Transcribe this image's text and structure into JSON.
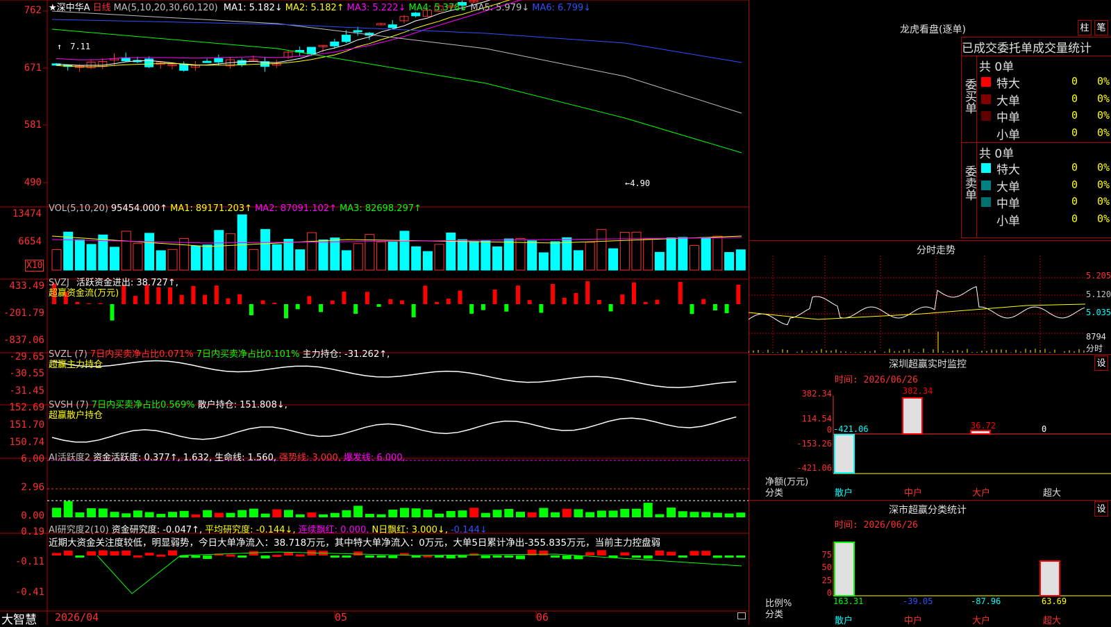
{
  "main": {
    "title": "★深中华A",
    "period": "日线",
    "ma_spec": "MA(5,10,20,30,60,120)",
    "ma": [
      {
        "label": "MA1:",
        "value": "5.182↓",
        "color": "#ffffff"
      },
      {
        "label": "MA2:",
        "value": "5.182↑",
        "color": "#ffff00"
      },
      {
        "label": "MA3:",
        "value": "5.222↓",
        "color": "#ff00ff"
      },
      {
        "label": "MA4:",
        "value": "5.378↓",
        "color": "#00ff00"
      },
      {
        "label": "MA5:",
        "value": "5.979↓",
        "color": "#c0c0c0"
      },
      {
        "label": "MA6:",
        "value": "6.799↓",
        "color": "#3050ff"
      }
    ],
    "y_labels": [
      "762",
      "671",
      "581",
      "490"
    ],
    "high_mark": "7.11",
    "low_mark": "←4.90"
  },
  "vol": {
    "header": "VOL(5,10,20)",
    "value": "95454.000↑",
    "ma": [
      {
        "label": "MA1:",
        "value": "89171.203↑",
        "color": "#ffff00"
      },
      {
        "label": "MA2:",
        "value": "87091.102↑",
        "color": "#ff00ff"
      },
      {
        "label": "MA3:",
        "value": "82698.297↑",
        "color": "#00ff00"
      }
    ],
    "y_labels": [
      "13474",
      "6654"
    ],
    "unit": "X10"
  },
  "svzj": {
    "name": "SVZJ",
    "text": "活跃资金进出: 38.727↑,",
    "sub": "超赢资金流(万元)",
    "y_labels": [
      "433.49",
      "-201.79",
      "-837.06"
    ]
  },
  "svzl": {
    "name": "SVZL (7)",
    "t1": "7日内买卖净占比0.071%",
    "t2": "7日内买卖净占比0.101%",
    "t3": "主力持仓: -31.262↑,",
    "sub": "超赢主力持仓",
    "y_labels": [
      "-29.65",
      "-30.55",
      "-31.45"
    ]
  },
  "svsh": {
    "name": "SVSH (7)",
    "t1": "7日内买卖净占比0.569%",
    "t2": "散户持仓: 151.808↓,",
    "sub": "超赢散户持仓",
    "y_labels": [
      "152.69",
      "151.70",
      "150.74"
    ]
  },
  "ai_active": {
    "name": "AI活跃度2",
    "t1": "资金活跃度: 0.377↑,",
    "t2": "1.632,",
    "t3": "生命线: 1.560,",
    "t4": "强势线: 3.000,",
    "t5": "爆发线: 6.000,",
    "y_labels": [
      "6.00",
      "2.96",
      "0.00"
    ]
  },
  "ai_research": {
    "name": "AI研究度2(10)",
    "t1": "资金研究度: -0.047↑,",
    "t2": "平均研究度: -0.144↓,",
    "t3": "连续飘红: 0.000,",
    "t4": "N日飘红: 3.000↓,",
    "t5": "-0.144↓",
    "comment": "近期大资金关注度较低，明显弱势，今日大单净流入：38.718万元，其中特大单净流入：0万元，大单5日累计净出-355.835万元，当前主力控盘弱",
    "y_labels": [
      "0.19",
      "-0.11",
      "-0.41"
    ]
  },
  "bottom": {
    "brand": "大智慧",
    "dates": [
      "2026/04",
      "05",
      "06"
    ]
  },
  "longhu": {
    "title": "龙虎看盘(逐单)",
    "btn1": "柱",
    "btn2": "笔",
    "subtitle": "已成交委托单成交量统计",
    "buy_label": "委买单",
    "sell_label": "委卖单",
    "buy_total": "共 0单",
    "sell_total": "共 0单",
    "buy_rows": [
      {
        "name": "特大",
        "count": "0",
        "pct": "0%",
        "color": "#ff0000"
      },
      {
        "name": "大单",
        "count": "0",
        "pct": "0%",
        "color": "#800000"
      },
      {
        "name": "中单",
        "count": "0",
        "pct": "0%",
        "color": "#600000"
      },
      {
        "name": "小单",
        "count": "0",
        "pct": "0%",
        "color": ""
      }
    ],
    "sell_rows": [
      {
        "name": "特大",
        "count": "0",
        "pct": "0%",
        "color": "#00ffff"
      },
      {
        "name": "大单",
        "count": "0",
        "pct": "0%",
        "color": "#008080"
      },
      {
        "name": "中单",
        "count": "0",
        "pct": "0%",
        "color": "#007070"
      },
      {
        "name": "小单",
        "count": "0",
        "pct": "0%",
        "color": ""
      }
    ]
  },
  "intraday": {
    "title": "分时走势",
    "prices": [
      "5.205",
      "5.120",
      "5.035"
    ],
    "vol_label": "8794",
    "vol_unit": "分时"
  },
  "sz_monitor": {
    "title": "深圳超赢实时监控",
    "btn": "设",
    "time": "时间: 2026/06/26",
    "y_labels": [
      "382.34",
      "114.54",
      "0",
      "-153.26",
      "-421.06"
    ],
    "values": [
      {
        "cat": "散户",
        "value": "-421.06",
        "color": "#00ffff"
      },
      {
        "cat": "中户",
        "value": "382.34",
        "color": "#ff0000"
      },
      {
        "cat": "大户",
        "value": "36.72",
        "color": "#ff0000"
      },
      {
        "cat": "超大",
        "value": "0",
        "color": "#ffffff"
      }
    ],
    "axis1": "净额(万元)",
    "axis2": "分类"
  },
  "sz_class": {
    "title": "深市超赢分类统计",
    "btn": "设",
    "time": "时间: 2026/06/26",
    "y_labels": [
      "75",
      "50",
      "25",
      "0"
    ],
    "values": [
      {
        "cat": "散户",
        "value": "163.31",
        "color": "#00ff00",
        "cat_color": "#00ff00"
      },
      {
        "cat": "中户",
        "value": "-39.05",
        "color": "#3050ff",
        "cat_color": "#ff0000"
      },
      {
        "cat": "大户",
        "value": "-87.96",
        "color": "#00ffff",
        "cat_color": "#ff0000"
      },
      {
        "cat": "超大",
        "value": "63.69",
        "color": "#ffff00",
        "cat_color": "#ff0000"
      }
    ],
    "axis1": "比例%",
    "axis2": "分类"
  }
}
